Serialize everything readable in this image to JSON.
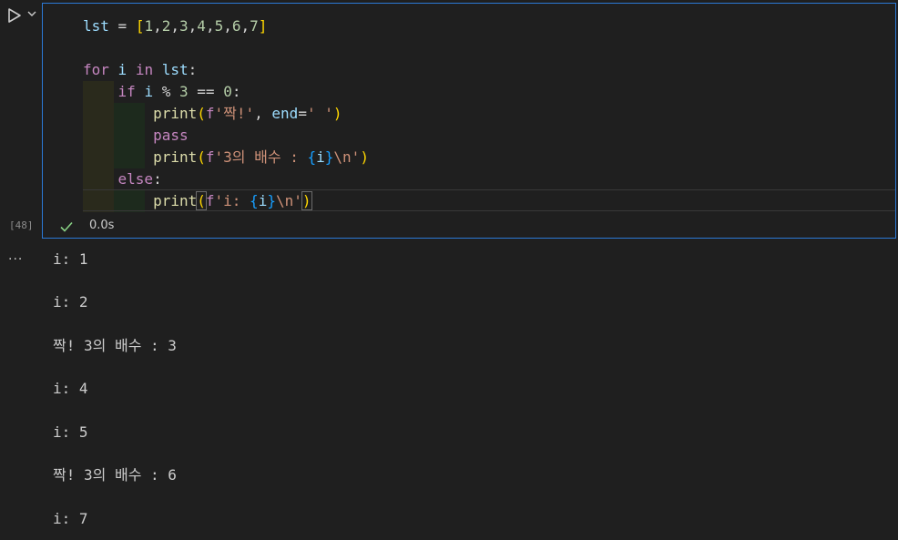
{
  "cell": {
    "execution_count": "[48]",
    "status_time": "0.0s",
    "code_lines": [
      "lst = [1,2,3,4,5,6,7]",
      "",
      "for i in lst:",
      "    if i % 3 == 0:",
      "        print(f'짝!', end=' ')",
      "        pass",
      "        print(f'3의 배수 : {i}\\n')",
      "    else:",
      "        print(f'i: {i}\\n')"
    ]
  },
  "toolbar": {
    "run_icon": "play-icon",
    "run_options_icon": "chevron-down-icon",
    "status_icon": "check-icon",
    "output_menu": "···"
  },
  "output": {
    "lines": [
      "i: 1",
      "i: 2",
      "짝! 3의 배수 : 3",
      "i: 4",
      "i: 5",
      "짝! 3의 배수 : 6",
      "i: 7"
    ]
  },
  "colors": {
    "background": "#1f1f1f",
    "focus_border": "#2b79d6",
    "keyword": "#c586c0",
    "function": "#dcdcaa",
    "string": "#ce9178",
    "number": "#b5cea8",
    "variable": "#9cdcfe",
    "success": "#89d185"
  }
}
